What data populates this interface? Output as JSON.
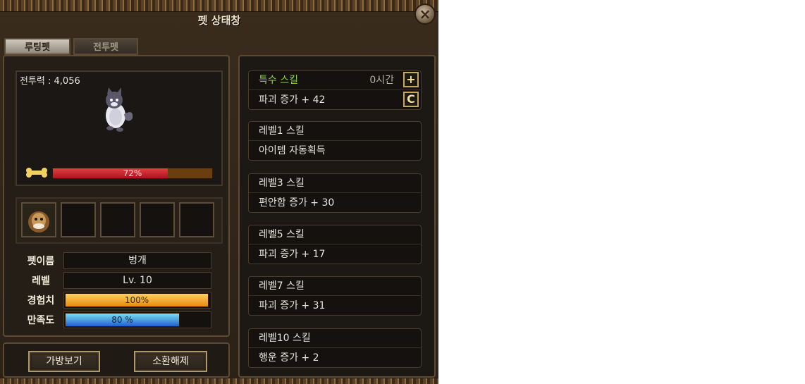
{
  "window": {
    "title": "펫 상태창"
  },
  "tabs": [
    {
      "label": "루팅펫",
      "active": true
    },
    {
      "label": "전투펫",
      "active": false
    }
  ],
  "pet_view": {
    "combat_power_label": "전투력 : 4,056",
    "hunger": {
      "value": 0.72,
      "text": "72%"
    }
  },
  "pet_info": {
    "name_label": "펫이름",
    "name_value": "벙개",
    "level_label": "레벨",
    "level_value": "Lv. 10",
    "exp_label": "경험치",
    "exp_value": 1.0,
    "exp_text": "100%",
    "satisfaction_label": "만족도",
    "satisfaction_value": 0.8,
    "satisfaction_text": "80 %"
  },
  "buttons": {
    "inventory": "가방보기",
    "dismiss": "소환해제"
  },
  "skills": [
    {
      "title": "특수 스킬",
      "effect": "파괴 증가 + 42",
      "time": "0시간",
      "special": true
    },
    {
      "title": "레벨1 스킬",
      "effect": "아이템 자동획득"
    },
    {
      "title": "레벨3 스킬",
      "effect": "편안함 증가 + 30"
    },
    {
      "title": "레벨5 스킬",
      "effect": "파괴 증가 + 17"
    },
    {
      "title": "레벨7 스킬",
      "effect": "파괴 증가 + 31"
    },
    {
      "title": "레벨10 스킬",
      "effect": "행운 증가 + 2"
    }
  ],
  "colors": {
    "hunger": "#d01c30",
    "exp": "#f0a020",
    "satisfaction": "#40a8e0",
    "special_skill": "#8fd24a"
  },
  "icons": {
    "close": "close-icon",
    "add": "plus-icon",
    "refresh": "refresh-icon",
    "bone": "bone-icon"
  }
}
